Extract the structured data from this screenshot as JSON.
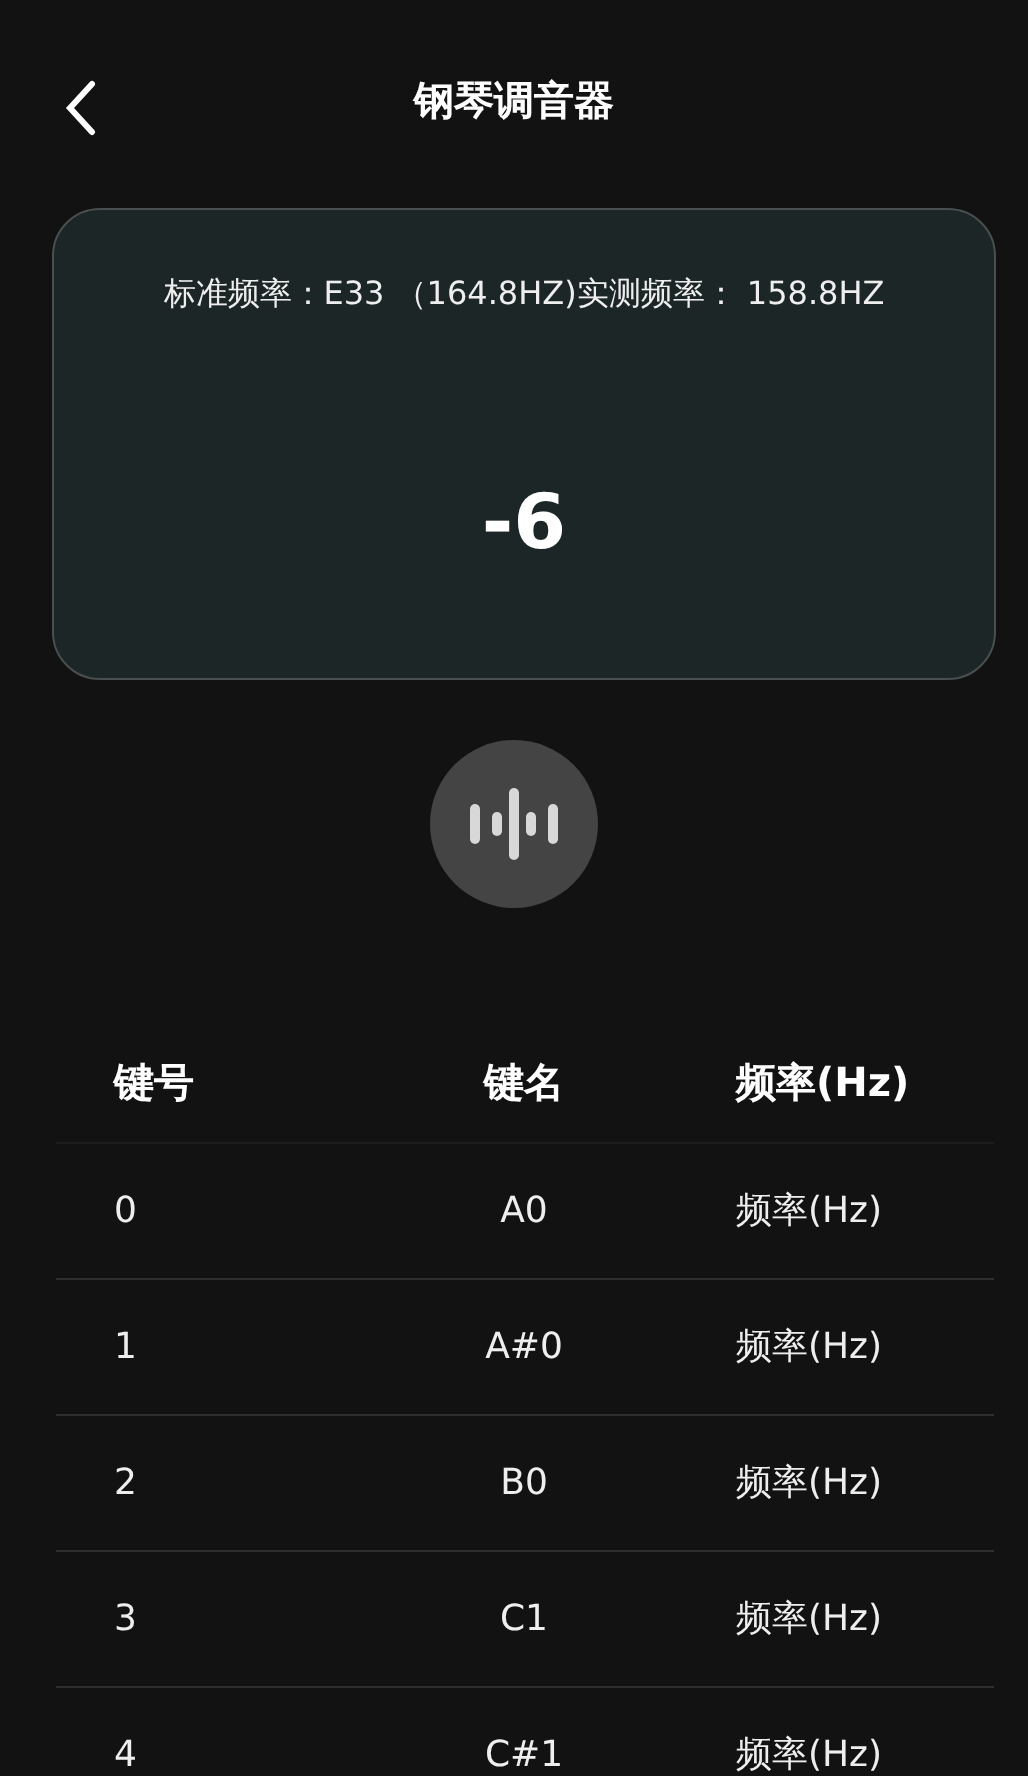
{
  "header": {
    "title": "钢琴调音器"
  },
  "reading_card": {
    "info": "标准频率：E33 （164.8HZ)实测频率： 158.8HZ",
    "deviation": "-6"
  },
  "table": {
    "columns": [
      "键号",
      "键名",
      "频率(Hz)"
    ],
    "rows": [
      [
        "0",
        "A0",
        "频率(Hz)"
      ],
      [
        "1",
        "A#0",
        "频率(Hz)"
      ],
      [
        "2",
        "B0",
        "频率(Hz)"
      ],
      [
        "3",
        "C1",
        "频率(Hz)"
      ],
      [
        "4",
        "C#1",
        "频率(Hz)"
      ]
    ]
  }
}
